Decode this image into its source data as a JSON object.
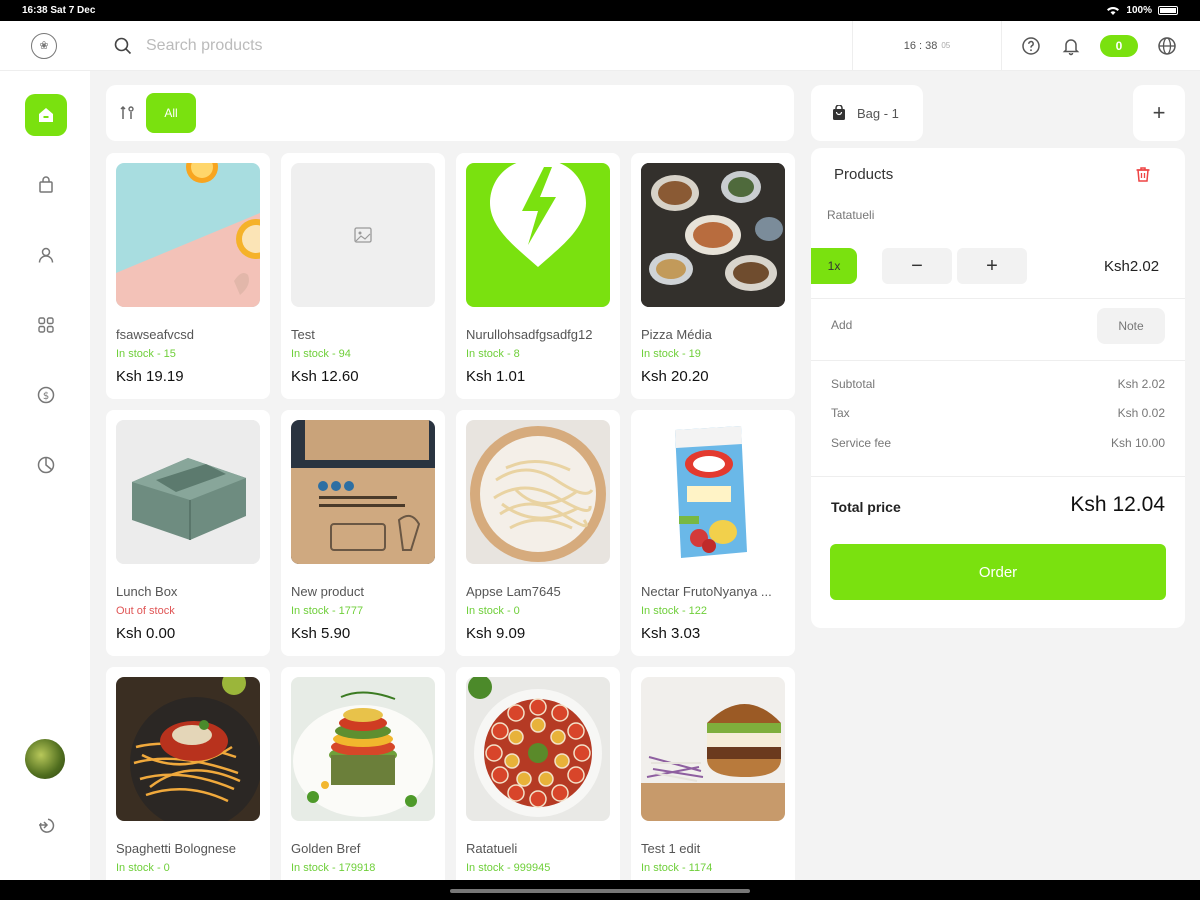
{
  "status_bar": {
    "time_date": "16:38 Sat 7 Dec",
    "battery": "100%"
  },
  "topbar": {
    "search_placeholder": "Search products",
    "clock_hm": "16 : 38",
    "clock_s": "05",
    "badge_count": "0"
  },
  "filter": {
    "all_label": "All"
  },
  "products": [
    {
      "name": "fsawseafvcsd",
      "stock": "In stock - 15",
      "price": "Ksh 19.19",
      "in_stock": true,
      "image": "oranges-pastel"
    },
    {
      "name": "Test",
      "stock": "In stock - 94",
      "price": "Ksh 12.60",
      "in_stock": true,
      "image": "placeholder-image"
    },
    {
      "name": "Nurullohsadfgsadfg12",
      "stock": "In stock - 8",
      "price": "Ksh 1.01",
      "in_stock": true,
      "image": "green-bolt-logo"
    },
    {
      "name": "Pizza Média",
      "stock": "In stock - 19",
      "price": "Ksh 20.20",
      "in_stock": true,
      "image": "food-platter"
    },
    {
      "name": "Lunch Box",
      "stock": "Out of stock",
      "price": "Ksh 0.00",
      "in_stock": false,
      "image": "lunch-box"
    },
    {
      "name": "New product",
      "stock": "In stock - 1777",
      "price": "Ksh 5.90",
      "in_stock": true,
      "image": "dishwasher-tablets"
    },
    {
      "name": "Appse Lam7645",
      "stock": "In stock - 0",
      "price": "Ksh 9.09",
      "in_stock": true,
      "image": "pasta-bowl"
    },
    {
      "name": "Nectar FrutoNyanya ...",
      "stock": "In stock - 122",
      "price": "Ksh 3.03",
      "in_stock": true,
      "image": "juice-box"
    },
    {
      "name": "Spaghetti Bolognese",
      "stock": "In stock - 0",
      "price": "",
      "in_stock": true,
      "image": "spaghetti"
    },
    {
      "name": "Golden Bref",
      "stock": "In stock - 179918",
      "price": "",
      "in_stock": true,
      "image": "ratatouille-stack"
    },
    {
      "name": "Ratatueli",
      "stock": "In stock - 999945",
      "price": "",
      "in_stock": true,
      "image": "ratatouille-dish"
    },
    {
      "name": "Test 1 edit",
      "stock": "In stock - 1174",
      "price": "",
      "in_stock": true,
      "image": "burger"
    }
  ],
  "bag": {
    "label": "Bag - 1"
  },
  "cart": {
    "heading": "Products",
    "item_name": "Ratatueli",
    "qty": "1x",
    "line_price": "Ksh2.02",
    "add_label": "Add",
    "note_label": "Note",
    "subtotal_label": "Subtotal",
    "subtotal_value": "Ksh 2.02",
    "tax_label": "Tax",
    "tax_value": "Ksh 0.02",
    "service_label": "Service fee",
    "service_value": "Ksh 10.00",
    "total_label": "Total price",
    "total_value": "Ksh 12.04",
    "order_label": "Order"
  },
  "colors": {
    "accent": "#7ae10f",
    "danger": "#e05555",
    "stock_green": "#6fcf3a"
  }
}
